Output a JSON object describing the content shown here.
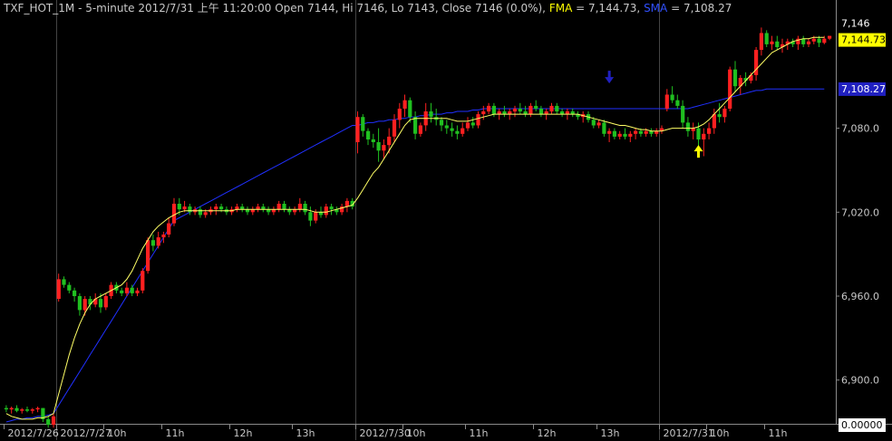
{
  "header": {
    "symbol": "TXF_HOT_1M",
    "interval": "5-minute",
    "datetime": "2012/7/31 上午 11:20:00",
    "open": "Open 7144",
    "high": "Hi 7146",
    "low": "Lo 7143",
    "close": "Close 7146 (0.0%)",
    "fma_label": "FMA",
    "fma_value": "= 7,144.73,",
    "sma_label": "SMA",
    "sma_value": "= 7,108.27"
  },
  "colors": {
    "background": "#000000",
    "up_candle": "#ff2020",
    "down_candle": "#20c020",
    "fma_line": "#ffff66",
    "sma_line": "#2030ff",
    "grid": "#444444",
    "axis_text": "#c8c8c8",
    "fma_box": "#ffff00",
    "sma_box": "#2020c0"
  },
  "chart_data": {
    "type": "candlestick",
    "title": "TXF_HOT_1M - 5-minute 2012/7/31 上午 11:20:00 Open 7144, Hi 7146, Lo 7143, Close 7146 (0.0%)",
    "ylim": [
      6870,
      7160
    ],
    "y_ticks": [
      {
        "value": 7080,
        "label": "7,080.0"
      },
      {
        "value": 7020,
        "label": "7,020.0"
      },
      {
        "value": 6960,
        "label": "6,960.0"
      },
      {
        "value": 6900,
        "label": "6,900.0"
      }
    ],
    "y_tags": {
      "last": {
        "value": 7146,
        "label": "7,146"
      },
      "fma": {
        "value": 7144.73,
        "label": "7,144.73"
      },
      "sma": {
        "value": 7108.27,
        "label": "7,108.27"
      },
      "bottom": {
        "label": "0.00000"
      }
    },
    "x_ticks": [
      {
        "index": 0,
        "label": "2012/7/26",
        "date": true
      },
      {
        "index": 10,
        "label": "2012/7/27",
        "date": true
      },
      {
        "index": 19,
        "label": "10h"
      },
      {
        "index": 30,
        "label": "11h"
      },
      {
        "index": 43,
        "label": "12h"
      },
      {
        "index": 55,
        "label": "13h"
      },
      {
        "index": 67,
        "label": "2012/7/30",
        "date": true
      },
      {
        "index": 76,
        "label": "10h"
      },
      {
        "index": 88,
        "label": "11h"
      },
      {
        "index": 101,
        "label": "12h"
      },
      {
        "index": 113,
        "label": "13h"
      },
      {
        "index": 125,
        "label": "2012/7/31",
        "date": true
      },
      {
        "index": 134,
        "label": "10h"
      },
      {
        "index": 145,
        "label": "11h"
      }
    ],
    "session_separators": [
      10,
      67,
      125
    ],
    "arrows": [
      {
        "type": "sell",
        "index": 115,
        "value": 7112
      },
      {
        "type": "buy",
        "index": 132,
        "value": 7068
      }
    ],
    "candles": [
      [
        6880,
        6882,
        6877,
        6879
      ],
      [
        6879,
        6881,
        6876,
        6880
      ],
      [
        6880,
        6882,
        6877,
        6878
      ],
      [
        6878,
        6880,
        6876,
        6879
      ],
      [
        6879,
        6881,
        6877,
        6878
      ],
      [
        6878,
        6880,
        6876,
        6879
      ],
      [
        6879,
        6881,
        6877,
        6880
      ],
      [
        6880,
        6880,
        6870,
        6872
      ],
      [
        6872,
        6874,
        6866,
        6868
      ],
      [
        6868,
        6876,
        6866,
        6874
      ],
      [
        6958,
        6976,
        6956,
        6972
      ],
      [
        6972,
        6974,
        6966,
        6968
      ],
      [
        6968,
        6970,
        6962,
        6964
      ],
      [
        6964,
        6966,
        6956,
        6960
      ],
      [
        6960,
        6962,
        6946,
        6950
      ],
      [
        6950,
        6960,
        6946,
        6958
      ],
      [
        6958,
        6960,
        6950,
        6954
      ],
      [
        6954,
        6962,
        6952,
        6958
      ],
      [
        6958,
        6962,
        6948,
        6952
      ],
      [
        6952,
        6962,
        6950,
        6960
      ],
      [
        6960,
        6970,
        6958,
        6968
      ],
      [
        6968,
        6970,
        6962,
        6964
      ],
      [
        6964,
        6966,
        6960,
        6962
      ],
      [
        6962,
        6970,
        6960,
        6966
      ],
      [
        6966,
        6968,
        6960,
        6962
      ],
      [
        6962,
        6966,
        6960,
        6964
      ],
      [
        6964,
        6980,
        6962,
        6978
      ],
      [
        6978,
        7002,
        6976,
        7000
      ],
      [
        7000,
        7004,
        6992,
        6996
      ],
      [
        6996,
        7006,
        6994,
        7002
      ],
      [
        7002,
        7006,
        6998,
        7004
      ],
      [
        7004,
        7016,
        7002,
        7012
      ],
      [
        7012,
        7030,
        7010,
        7026
      ],
      [
        7026,
        7030,
        7018,
        7022
      ],
      [
        7022,
        7028,
        7020,
        7024
      ],
      [
        7024,
        7026,
        7018,
        7020
      ],
      [
        7020,
        7024,
        7018,
        7022
      ],
      [
        7022,
        7024,
        7016,
        7018
      ],
      [
        7018,
        7022,
        7016,
        7020
      ],
      [
        7020,
        7024,
        7018,
        7022
      ],
      [
        7022,
        7026,
        7018,
        7024
      ],
      [
        7024,
        7026,
        7020,
        7022
      ],
      [
        7022,
        7024,
        7018,
        7020
      ],
      [
        7020,
        7024,
        7018,
        7022
      ],
      [
        7022,
        7026,
        7020,
        7024
      ],
      [
        7024,
        7026,
        7020,
        7022
      ],
      [
        7022,
        7024,
        7018,
        7020
      ],
      [
        7020,
        7024,
        7018,
        7022
      ],
      [
        7022,
        7026,
        7020,
        7024
      ],
      [
        7024,
        7026,
        7020,
        7022
      ],
      [
        7022,
        7024,
        7018,
        7020
      ],
      [
        7020,
        7024,
        7018,
        7022
      ],
      [
        7022,
        7028,
        7020,
        7026
      ],
      [
        7026,
        7028,
        7020,
        7022
      ],
      [
        7022,
        7024,
        7018,
        7020
      ],
      [
        7020,
        7024,
        7018,
        7022
      ],
      [
        7022,
        7030,
        7020,
        7026
      ],
      [
        7026,
        7028,
        7018,
        7020
      ],
      [
        7020,
        7024,
        7010,
        7014
      ],
      [
        7014,
        7022,
        7012,
        7020
      ],
      [
        7020,
        7024,
        7016,
        7018
      ],
      [
        7018,
        7026,
        7016,
        7024
      ],
      [
        7024,
        7026,
        7018,
        7022
      ],
      [
        7022,
        7024,
        7018,
        7020
      ],
      [
        7020,
        7026,
        7018,
        7024
      ],
      [
        7024,
        7030,
        7020,
        7028
      ],
      [
        7028,
        7030,
        7022,
        7024
      ],
      [
        7070,
        7092,
        7062,
        7088
      ],
      [
        7088,
        7090,
        7074,
        7078
      ],
      [
        7078,
        7080,
        7068,
        7072
      ],
      [
        7072,
        7076,
        7066,
        7070
      ],
      [
        7070,
        7080,
        7056,
        7064
      ],
      [
        7064,
        7072,
        7058,
        7068
      ],
      [
        7068,
        7080,
        7062,
        7074
      ],
      [
        7074,
        7090,
        7070,
        7086
      ],
      [
        7086,
        7098,
        7080,
        7094
      ],
      [
        7094,
        7104,
        7088,
        7100
      ],
      [
        7100,
        7102,
        7084,
        7088
      ],
      [
        7088,
        7092,
        7072,
        7076
      ],
      [
        7076,
        7084,
        7074,
        7082
      ],
      [
        7082,
        7098,
        7078,
        7092
      ],
      [
        7092,
        7098,
        7084,
        7088
      ],
      [
        7088,
        7094,
        7082,
        7086
      ],
      [
        7086,
        7088,
        7078,
        7082
      ],
      [
        7082,
        7086,
        7076,
        7080
      ],
      [
        7080,
        7084,
        7074,
        7078
      ],
      [
        7078,
        7082,
        7072,
        7076
      ],
      [
        7076,
        7084,
        7074,
        7080
      ],
      [
        7080,
        7088,
        7078,
        7084
      ],
      [
        7084,
        7088,
        7080,
        7082
      ],
      [
        7082,
        7092,
        7080,
        7090
      ],
      [
        7090,
        7096,
        7086,
        7092
      ],
      [
        7092,
        7098,
        7090,
        7096
      ],
      [
        7096,
        7098,
        7088,
        7090
      ],
      [
        7090,
        7094,
        7086,
        7092
      ],
      [
        7092,
        7096,
        7088,
        7090
      ],
      [
        7090,
        7094,
        7086,
        7092
      ],
      [
        7092,
        7096,
        7088,
        7094
      ],
      [
        7094,
        7098,
        7090,
        7092
      ],
      [
        7092,
        7096,
        7088,
        7090
      ],
      [
        7090,
        7098,
        7088,
        7096
      ],
      [
        7096,
        7100,
        7092,
        7094
      ],
      [
        7094,
        7096,
        7088,
        7090
      ],
      [
        7090,
        7094,
        7086,
        7092
      ],
      [
        7092,
        7098,
        7090,
        7096
      ],
      [
        7096,
        7098,
        7090,
        7092
      ],
      [
        7092,
        7094,
        7088,
        7090
      ],
      [
        7090,
        7094,
        7086,
        7092
      ],
      [
        7092,
        7094,
        7088,
        7090
      ],
      [
        7090,
        7092,
        7086,
        7088
      ],
      [
        7088,
        7092,
        7084,
        7090
      ],
      [
        7090,
        7092,
        7084,
        7086
      ],
      [
        7086,
        7088,
        7080,
        7082
      ],
      [
        7082,
        7086,
        7080,
        7084
      ],
      [
        7084,
        7086,
        7074,
        7076
      ],
      [
        7076,
        7080,
        7070,
        7078
      ],
      [
        7078,
        7080,
        7072,
        7074
      ],
      [
        7074,
        7078,
        7072,
        7076
      ],
      [
        7076,
        7080,
        7072,
        7074
      ],
      [
        7074,
        7078,
        7070,
        7076
      ],
      [
        7076,
        7080,
        7072,
        7078
      ],
      [
        7078,
        7080,
        7074,
        7076
      ],
      [
        7076,
        7080,
        7074,
        7078
      ],
      [
        7078,
        7080,
        7074,
        7076
      ],
      [
        7076,
        7080,
        7074,
        7078
      ],
      [
        7078,
        7082,
        7076,
        7080
      ],
      [
        7094,
        7108,
        7092,
        7104
      ],
      [
        7104,
        7110,
        7098,
        7100
      ],
      [
        7100,
        7104,
        7094,
        7096
      ],
      [
        7096,
        7100,
        7080,
        7084
      ],
      [
        7084,
        7088,
        7074,
        7078
      ],
      [
        7078,
        7084,
        7072,
        7080
      ],
      [
        7080,
        7084,
        7066,
        7072
      ],
      [
        7072,
        7080,
        7060,
        7076
      ],
      [
        7076,
        7084,
        7072,
        7080
      ],
      [
        7080,
        7094,
        7076,
        7090
      ],
      [
        7090,
        7098,
        7084,
        7088
      ],
      [
        7088,
        7096,
        7084,
        7094
      ],
      [
        7094,
        7124,
        7092,
        7122
      ],
      [
        7122,
        7128,
        7106,
        7110
      ],
      [
        7110,
        7118,
        7104,
        7116
      ],
      [
        7116,
        7120,
        7110,
        7114
      ],
      [
        7114,
        7120,
        7112,
        7118
      ],
      [
        7118,
        7138,
        7114,
        7136
      ],
      [
        7136,
        7152,
        7132,
        7148
      ],
      [
        7148,
        7150,
        7138,
        7140
      ],
      [
        7140,
        7146,
        7136,
        7142
      ],
      [
        7142,
        7146,
        7136,
        7138
      ],
      [
        7138,
        7144,
        7134,
        7140
      ],
      [
        7140,
        7144,
        7136,
        7142
      ],
      [
        7142,
        7144,
        7138,
        7140
      ],
      [
        7140,
        7146,
        7136,
        7144
      ],
      [
        7144,
        7146,
        7138,
        7140
      ],
      [
        7140,
        7144,
        7138,
        7142
      ],
      [
        7142,
        7146,
        7140,
        7144
      ],
      [
        7144,
        7146,
        7138,
        7141
      ],
      [
        7141,
        7146,
        7140,
        7144
      ],
      [
        7144,
        7146,
        7143,
        7146
      ]
    ],
    "fma": [
      6876,
      6874,
      6873,
      6872,
      6872,
      6872,
      6873,
      6873,
      6874,
      6876,
      6890,
      6904,
      6918,
      6930,
      6940,
      6948,
      6954,
      6958,
      6960,
      6962,
      6964,
      6966,
      6968,
      6972,
      6978,
      6986,
      6994,
      7000,
      7006,
      7010,
      7013,
      7016,
      7018,
      7020,
      7021,
      7021,
      7021,
      7021,
      7021,
      7021,
      7021,
      7021,
      7021,
      7021,
      7022,
      7022,
      7022,
      7022,
      7022,
      7022,
      7022,
      7022,
      7022,
      7022,
      7022,
      7022,
      7022,
      7022,
      7021,
      7020,
      7020,
      7020,
      7021,
      7022,
      7023,
      7024,
      7025,
      7030,
      7036,
      7042,
      7048,
      7052,
      7058,
      7064,
      7070,
      7076,
      7082,
      7086,
      7087,
      7087,
      7087,
      7087,
      7087,
      7087,
      7087,
      7086,
      7085,
      7085,
      7085,
      7086,
      7087,
      7088,
      7089,
      7090,
      7090,
      7090,
      7090,
      7090,
      7090,
      7090,
      7090,
      7090,
      7090,
      7090,
      7090,
      7090,
      7090,
      7090,
      7090,
      7090,
      7089,
      7088,
      7087,
      7086,
      7085,
      7084,
      7083,
      7082,
      7082,
      7081,
      7080,
      7079,
      7079,
      7078,
      7078,
      7078,
      7079,
      7080,
      7080,
      7080,
      7080,
      7080,
      7081,
      7083,
      7086,
      7090,
      7094,
      7098,
      7102,
      7106,
      7110,
      7114,
      7118,
      7122,
      7126,
      7130,
      7134,
      7136,
      7138,
      7140,
      7142,
      7143,
      7144,
      7144,
      7145,
      7145,
      7145
    ],
    "sma": [
      6870,
      6871,
      6872,
      6872,
      6873,
      6873,
      6874,
      6874,
      6875,
      6876,
      6882,
      6888,
      6894,
      6900,
      6906,
      6912,
      6918,
      6924,
      6930,
      6936,
      6942,
      6948,
      6954,
      6960,
      6966,
      6972,
      6978,
      6984,
      6990,
      6996,
      7002,
      7008,
      7014,
      7016,
      7018,
      7020,
      7022,
      7024,
      7026,
      7028,
      7030,
      7032,
      7034,
      7036,
      7038,
      7040,
      7042,
      7044,
      7046,
      7048,
      7050,
      7052,
      7054,
      7056,
      7058,
      7060,
      7062,
      7064,
      7066,
      7068,
      7070,
      7072,
      7074,
      7076,
      7078,
      7080,
      7082,
      7082,
      7083,
      7084,
      7084,
      7085,
      7085,
      7086,
      7086,
      7087,
      7087,
      7088,
      7088,
      7089,
      7089,
      7090,
      7090,
      7090,
      7091,
      7091,
      7092,
      7092,
      7092,
      7093,
      7093,
      7094,
      7094,
      7094,
      7094,
      7094,
      7094,
      7094,
      7094,
      7094,
      7094,
      7094,
      7094,
      7094,
      7094,
      7094,
      7094,
      7094,
      7094,
      7094,
      7094,
      7094,
      7094,
      7094,
      7094,
      7094,
      7094,
      7094,
      7094,
      7094,
      7094,
      7094,
      7094,
      7094,
      7094,
      7094,
      7094,
      7094,
      7094,
      7094,
      7094,
      7095,
      7096,
      7097,
      7098,
      7099,
      7100,
      7101,
      7102,
      7103,
      7104,
      7105,
      7106,
      7107,
      7107,
      7108,
      7108,
      7108,
      7108,
      7108,
      7108,
      7108,
      7108,
      7108,
      7108,
      7108,
      7108
    ]
  }
}
